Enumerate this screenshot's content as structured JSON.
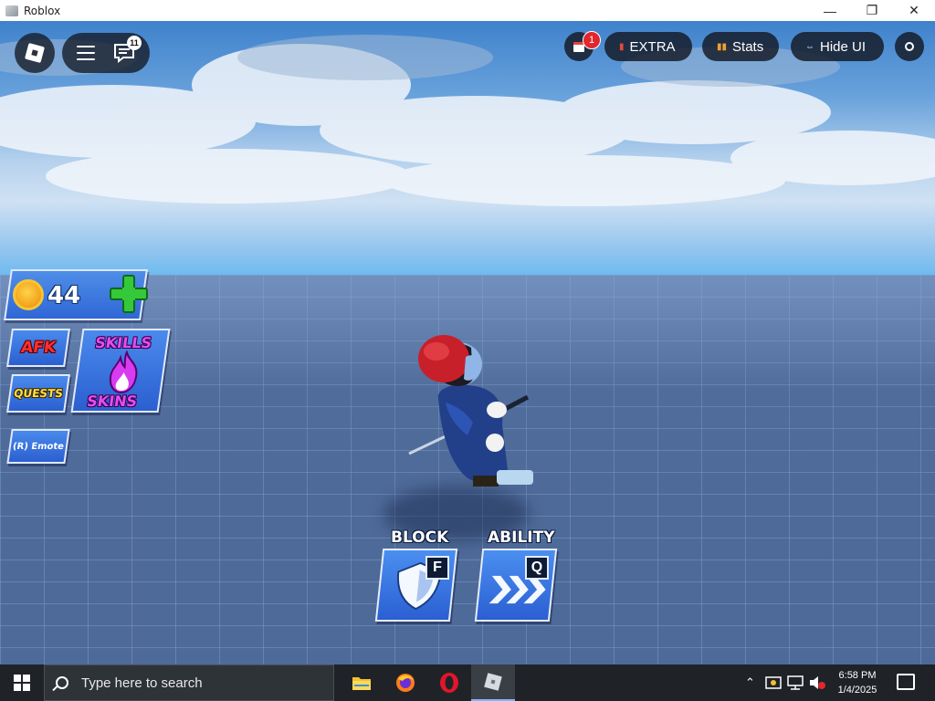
{
  "window": {
    "title": "Roblox",
    "minimize_glyph": "—",
    "restore_glyph": "❐",
    "close_glyph": "✕"
  },
  "roblox_topbar": {
    "chat_badge": "11",
    "calendar_badge": "1",
    "extra_label": "EXTRA",
    "stats_label": "Stats",
    "hide_ui_label": "Hide UI"
  },
  "hud": {
    "coins": "44",
    "afk_label": "AFK",
    "quests_label": "QUESTS",
    "skills_label": "SKILLS",
    "skins_label": "SKINS",
    "emote_label": "(R) Emote"
  },
  "abilities": {
    "block_label": "BLOCK",
    "block_key": "F",
    "ability_label": "ABILITY",
    "ability_key": "Q"
  },
  "taskbar": {
    "search_placeholder": "Type here to search",
    "apps": [
      "file-explorer",
      "firefox",
      "opera",
      "roblox"
    ],
    "time": "6:58 PM",
    "date": "1/4/2025",
    "tray_chevron": "⌃"
  },
  "colors": {
    "hud_blue": "#2f66d6",
    "afk_red": "#ff3030",
    "quests_yellow": "#ffe14a",
    "skills_purple": "#e34cf5",
    "badge_red": "#e1262e",
    "taskbar_bg": "#1f2328"
  }
}
